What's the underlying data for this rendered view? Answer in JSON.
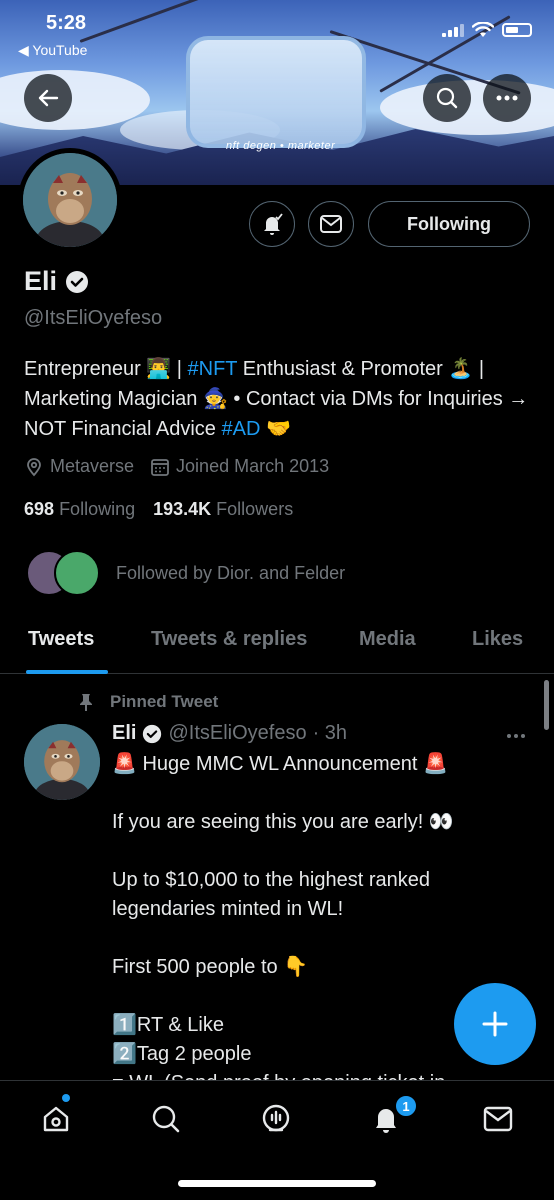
{
  "status": {
    "time": "5:28",
    "back_app": "◀ YouTube"
  },
  "banner": {
    "logo_caption": "nft degen • marketer"
  },
  "profile": {
    "name": "Eli",
    "handle": "@ItsEliOyefeso",
    "bio_parts": [
      "Entrepreneur 👨‍💻 | ",
      "#NFT",
      " Enthusiast & Promoter 🏝️ | Marketing Magician 🧙 • Contact via DMs for Inquiries → NOT Financial Advice ",
      "#AD",
      " 🤝"
    ],
    "location": "Metaverse",
    "joined": "Joined March 2013",
    "following_count": "698",
    "following_label": "Following",
    "followers_count": "193.4K",
    "followers_label": "Followers",
    "followed_by": "Followed by Dior. and Felder",
    "following_button": "Following"
  },
  "tabs": [
    {
      "label": "Tweets",
      "active": true
    },
    {
      "label": "Tweets & replies",
      "active": false
    },
    {
      "label": "Media",
      "active": false
    },
    {
      "label": "Likes",
      "active": false
    }
  ],
  "tweet": {
    "pinned_label": "Pinned Tweet",
    "author_name": "Eli",
    "author_handle": "@ItsEliOyefeso",
    "time": "· 3h",
    "lines": [
      "🚨 Huge MMC WL Announcement 🚨",
      "If you are seeing this you are early! 👀",
      "Up to $10,000 to the highest ranked legendaries minted in WL!",
      "First 500 people to 👇",
      "1️⃣RT & Like",
      "2️⃣Tag 2 people",
      "= WL (Send proof by opening ticket in"
    ]
  },
  "nav": {
    "notification_badge": "1"
  },
  "colors": {
    "accent": "#1d9bf0",
    "background": "#000000",
    "muted": "#71767b"
  }
}
